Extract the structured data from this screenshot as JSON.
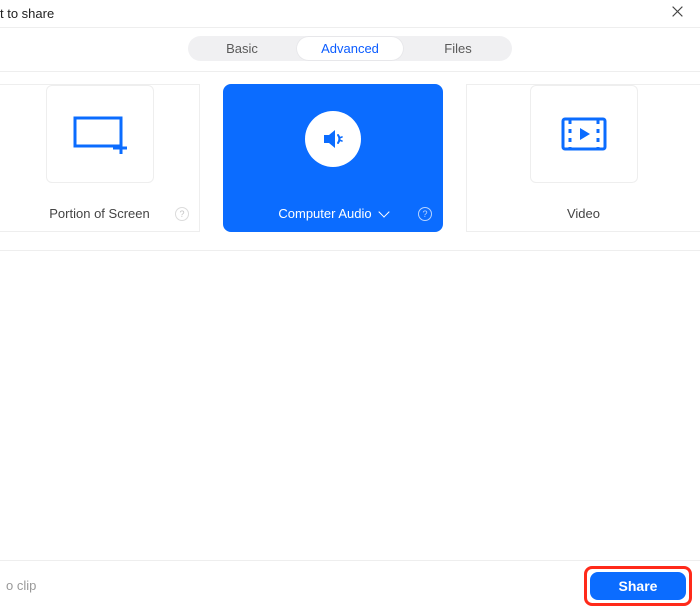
{
  "window": {
    "title_fragment": "t to share"
  },
  "tabs": {
    "basic": "Basic",
    "advanced": "Advanced",
    "files": "Files",
    "active": "advanced"
  },
  "options": {
    "portion": {
      "label": "Portion of Screen",
      "icon": "screen-portion-icon"
    },
    "audio": {
      "label": "Computer Audio",
      "icon": "speaker-icon"
    },
    "video": {
      "label": "Video",
      "icon": "film-icon"
    },
    "selected": "audio"
  },
  "footer": {
    "hint_fragment": "o clip",
    "share_label": "Share"
  },
  "colors": {
    "accent": "#0b6cff",
    "highlight_ring": "#ff2a1a"
  }
}
